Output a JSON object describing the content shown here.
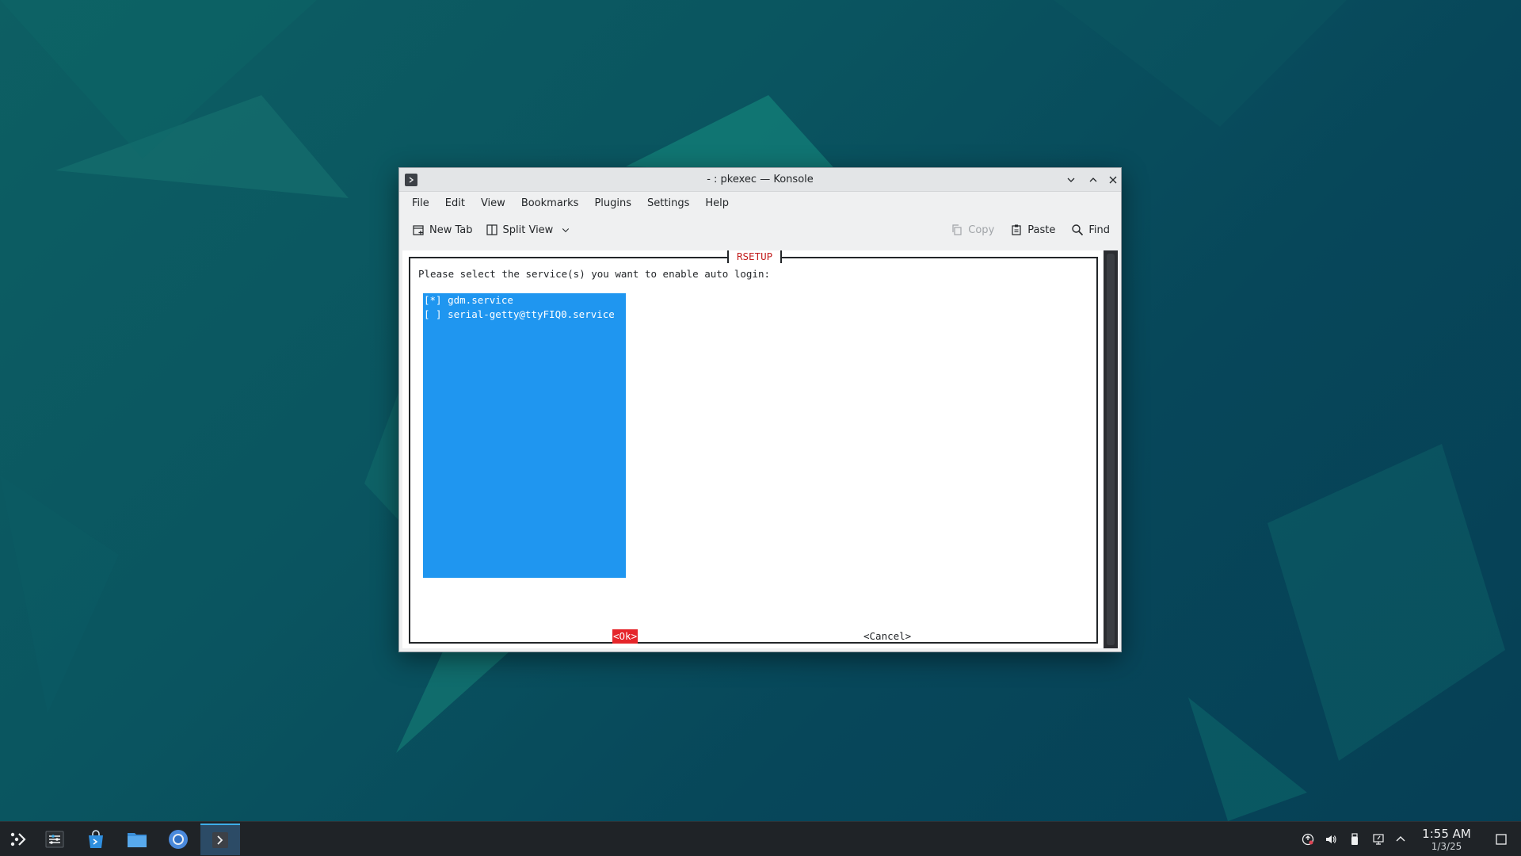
{
  "window": {
    "title": "- : pkexec — Konsole",
    "menu": [
      "File",
      "Edit",
      "View",
      "Bookmarks",
      "Plugins",
      "Settings",
      "Help"
    ],
    "toolbar": {
      "new_tab": "New Tab",
      "split_view": "Split View",
      "copy": "Copy",
      "paste": "Paste",
      "find": "Find"
    }
  },
  "dialog": {
    "title": "RSETUP",
    "prompt": "Please select the service(s) you want to enable auto login:",
    "items": [
      {
        "label": "[*] gdm.service",
        "checked": true
      },
      {
        "label": "[ ] serial-getty@ttyFIQ0.service",
        "checked": false
      }
    ],
    "ok": "<Ok>",
    "cancel": "<Cancel>"
  },
  "taskbar": {
    "apps": [
      "application-launcher-icon",
      "system-settings-icon",
      "discover-store-icon",
      "file-manager-icon",
      "chromium-browser-icon",
      "konsole-icon"
    ],
    "clock": {
      "time": "1:55 AM",
      "date": "1/3/25"
    }
  },
  "colors": {
    "selection_blue": "#1f96f0",
    "ok_red": "#e5252a",
    "title_red": "#c21d1d",
    "taskbar_bg": "#1f2327"
  }
}
